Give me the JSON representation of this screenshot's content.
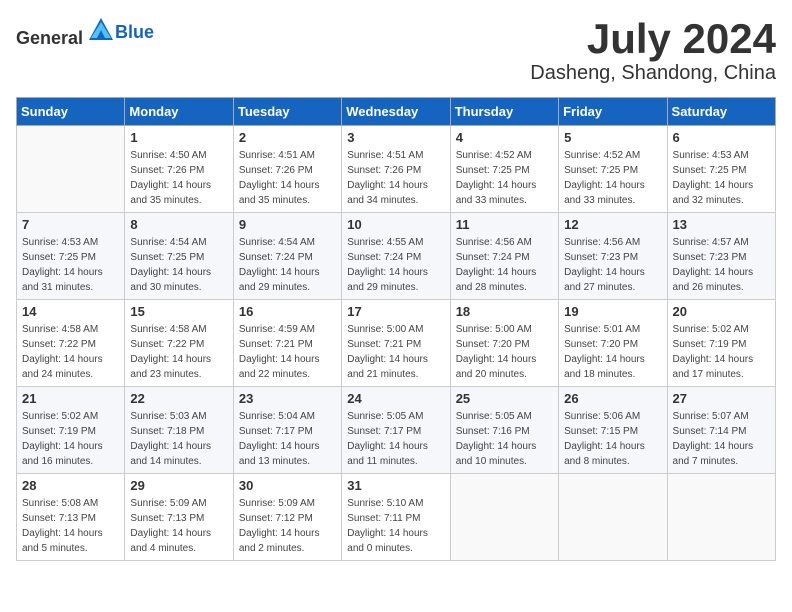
{
  "header": {
    "logo_general": "General",
    "logo_blue": "Blue",
    "month_year": "July 2024",
    "location": "Dasheng, Shandong, China"
  },
  "days_of_week": [
    "Sunday",
    "Monday",
    "Tuesday",
    "Wednesday",
    "Thursday",
    "Friday",
    "Saturday"
  ],
  "weeks": [
    [
      {
        "day": "",
        "sunrise": "",
        "sunset": "",
        "daylight": "",
        "empty": true
      },
      {
        "day": "1",
        "sunrise": "Sunrise: 4:50 AM",
        "sunset": "Sunset: 7:26 PM",
        "daylight": "Daylight: 14 hours and 35 minutes."
      },
      {
        "day": "2",
        "sunrise": "Sunrise: 4:51 AM",
        "sunset": "Sunset: 7:26 PM",
        "daylight": "Daylight: 14 hours and 35 minutes."
      },
      {
        "day": "3",
        "sunrise": "Sunrise: 4:51 AM",
        "sunset": "Sunset: 7:26 PM",
        "daylight": "Daylight: 14 hours and 34 minutes."
      },
      {
        "day": "4",
        "sunrise": "Sunrise: 4:52 AM",
        "sunset": "Sunset: 7:25 PM",
        "daylight": "Daylight: 14 hours and 33 minutes."
      },
      {
        "day": "5",
        "sunrise": "Sunrise: 4:52 AM",
        "sunset": "Sunset: 7:25 PM",
        "daylight": "Daylight: 14 hours and 33 minutes."
      },
      {
        "day": "6",
        "sunrise": "Sunrise: 4:53 AM",
        "sunset": "Sunset: 7:25 PM",
        "daylight": "Daylight: 14 hours and 32 minutes."
      }
    ],
    [
      {
        "day": "7",
        "sunrise": "Sunrise: 4:53 AM",
        "sunset": "Sunset: 7:25 PM",
        "daylight": "Daylight: 14 hours and 31 minutes."
      },
      {
        "day": "8",
        "sunrise": "Sunrise: 4:54 AM",
        "sunset": "Sunset: 7:25 PM",
        "daylight": "Daylight: 14 hours and 30 minutes."
      },
      {
        "day": "9",
        "sunrise": "Sunrise: 4:54 AM",
        "sunset": "Sunset: 7:24 PM",
        "daylight": "Daylight: 14 hours and 29 minutes."
      },
      {
        "day": "10",
        "sunrise": "Sunrise: 4:55 AM",
        "sunset": "Sunset: 7:24 PM",
        "daylight": "Daylight: 14 hours and 29 minutes."
      },
      {
        "day": "11",
        "sunrise": "Sunrise: 4:56 AM",
        "sunset": "Sunset: 7:24 PM",
        "daylight": "Daylight: 14 hours and 28 minutes."
      },
      {
        "day": "12",
        "sunrise": "Sunrise: 4:56 AM",
        "sunset": "Sunset: 7:23 PM",
        "daylight": "Daylight: 14 hours and 27 minutes."
      },
      {
        "day": "13",
        "sunrise": "Sunrise: 4:57 AM",
        "sunset": "Sunset: 7:23 PM",
        "daylight": "Daylight: 14 hours and 26 minutes."
      }
    ],
    [
      {
        "day": "14",
        "sunrise": "Sunrise: 4:58 AM",
        "sunset": "Sunset: 7:22 PM",
        "daylight": "Daylight: 14 hours and 24 minutes."
      },
      {
        "day": "15",
        "sunrise": "Sunrise: 4:58 AM",
        "sunset": "Sunset: 7:22 PM",
        "daylight": "Daylight: 14 hours and 23 minutes."
      },
      {
        "day": "16",
        "sunrise": "Sunrise: 4:59 AM",
        "sunset": "Sunset: 7:21 PM",
        "daylight": "Daylight: 14 hours and 22 minutes."
      },
      {
        "day": "17",
        "sunrise": "Sunrise: 5:00 AM",
        "sunset": "Sunset: 7:21 PM",
        "daylight": "Daylight: 14 hours and 21 minutes."
      },
      {
        "day": "18",
        "sunrise": "Sunrise: 5:00 AM",
        "sunset": "Sunset: 7:20 PM",
        "daylight": "Daylight: 14 hours and 20 minutes."
      },
      {
        "day": "19",
        "sunrise": "Sunrise: 5:01 AM",
        "sunset": "Sunset: 7:20 PM",
        "daylight": "Daylight: 14 hours and 18 minutes."
      },
      {
        "day": "20",
        "sunrise": "Sunrise: 5:02 AM",
        "sunset": "Sunset: 7:19 PM",
        "daylight": "Daylight: 14 hours and 17 minutes."
      }
    ],
    [
      {
        "day": "21",
        "sunrise": "Sunrise: 5:02 AM",
        "sunset": "Sunset: 7:19 PM",
        "daylight": "Daylight: 14 hours and 16 minutes."
      },
      {
        "day": "22",
        "sunrise": "Sunrise: 5:03 AM",
        "sunset": "Sunset: 7:18 PM",
        "daylight": "Daylight: 14 hours and 14 minutes."
      },
      {
        "day": "23",
        "sunrise": "Sunrise: 5:04 AM",
        "sunset": "Sunset: 7:17 PM",
        "daylight": "Daylight: 14 hours and 13 minutes."
      },
      {
        "day": "24",
        "sunrise": "Sunrise: 5:05 AM",
        "sunset": "Sunset: 7:17 PM",
        "daylight": "Daylight: 14 hours and 11 minutes."
      },
      {
        "day": "25",
        "sunrise": "Sunrise: 5:05 AM",
        "sunset": "Sunset: 7:16 PM",
        "daylight": "Daylight: 14 hours and 10 minutes."
      },
      {
        "day": "26",
        "sunrise": "Sunrise: 5:06 AM",
        "sunset": "Sunset: 7:15 PM",
        "daylight": "Daylight: 14 hours and 8 minutes."
      },
      {
        "day": "27",
        "sunrise": "Sunrise: 5:07 AM",
        "sunset": "Sunset: 7:14 PM",
        "daylight": "Daylight: 14 hours and 7 minutes."
      }
    ],
    [
      {
        "day": "28",
        "sunrise": "Sunrise: 5:08 AM",
        "sunset": "Sunset: 7:13 PM",
        "daylight": "Daylight: 14 hours and 5 minutes."
      },
      {
        "day": "29",
        "sunrise": "Sunrise: 5:09 AM",
        "sunset": "Sunset: 7:13 PM",
        "daylight": "Daylight: 14 hours and 4 minutes."
      },
      {
        "day": "30",
        "sunrise": "Sunrise: 5:09 AM",
        "sunset": "Sunset: 7:12 PM",
        "daylight": "Daylight: 14 hours and 2 minutes."
      },
      {
        "day": "31",
        "sunrise": "Sunrise: 5:10 AM",
        "sunset": "Sunset: 7:11 PM",
        "daylight": "Daylight: 14 hours and 0 minutes."
      },
      {
        "day": "",
        "sunrise": "",
        "sunset": "",
        "daylight": "",
        "empty": true
      },
      {
        "day": "",
        "sunrise": "",
        "sunset": "",
        "daylight": "",
        "empty": true
      },
      {
        "day": "",
        "sunrise": "",
        "sunset": "",
        "daylight": "",
        "empty": true
      }
    ]
  ]
}
